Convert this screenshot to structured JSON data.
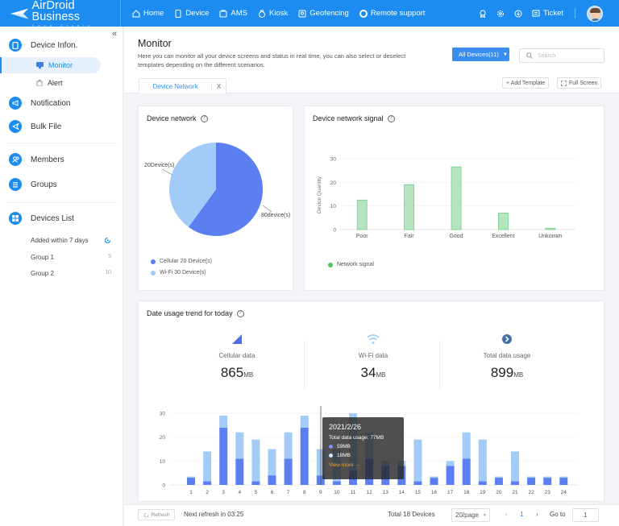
{
  "topbar": {
    "brand": "AirDroid Business",
    "brand_sub": "Sand Studio",
    "nav": [
      {
        "label": "Home",
        "icon": "home-icon"
      },
      {
        "label": "Device",
        "icon": "device-icon"
      },
      {
        "label": "AMS",
        "icon": "ams-icon"
      },
      {
        "label": "Kiosk",
        "icon": "kiosk-icon"
      },
      {
        "label": "Geofencing",
        "icon": "geofencing-icon"
      },
      {
        "label": "Remote support",
        "icon": "remote-support-icon"
      }
    ],
    "ticket_label": "Ticket"
  },
  "sidebar": {
    "collapse": "«",
    "device_info": "Device Infon.",
    "monitor": "Monitor",
    "alert": "Alert",
    "notification": "Notification",
    "bulk_file": "Bulk File",
    "members": "Members",
    "groups": "Groups",
    "devices_list": "Devices List",
    "lists": [
      {
        "label": "Added within 7 days",
        "count": ""
      },
      {
        "label": "Group 1",
        "count": "5"
      },
      {
        "label": "Group 2",
        "count": "10"
      }
    ]
  },
  "header": {
    "title": "Monitor",
    "description": "Here you can monitor all your device screens and status in real time, you can also select or deselect templates depending on the different scenarios.",
    "all_devices": "All Devices(11)",
    "search_placeholder": "Search",
    "tab_label": "Device Network",
    "tab_close": "X",
    "add_template": "+ Add Template",
    "full_screen": "Full Screen"
  },
  "device_network": {
    "title": "Device network",
    "help": "?",
    "label_left": "20Device(s)",
    "label_right": "80device(s)",
    "legend": [
      {
        "label": "Cellular  20 Device(s)",
        "color": "#5b7ff0"
      },
      {
        "label": "Wi-Fi  30 Device(s)",
        "color": "#a3cbf7"
      }
    ]
  },
  "network_signal": {
    "title": "Device network signal",
    "help": "?",
    "legend": "Network signal",
    "legend_color": "#4cc55e"
  },
  "usage": {
    "title": "Date usage trend for today",
    "help": "?",
    "stats": [
      {
        "label": "Cellular data",
        "value": "865",
        "unit": "MB"
      },
      {
        "label": "Wi-Fi data",
        "value": "34",
        "unit": "MB"
      },
      {
        "label": "Total data usage",
        "value": "899",
        "unit": "MB"
      }
    ],
    "tooltip": {
      "date": "2021/2/26",
      "total": "Total data usage: 77MB",
      "cellular": "59MB",
      "wifi": "18MB",
      "more": "View more →"
    }
  },
  "footer": {
    "refresh": "Refresh",
    "next_refresh": "Next refresh in 03:25",
    "total": "Total 18 Devices",
    "per_page": "20/page",
    "page": "1",
    "goto_label": "Go to",
    "goto_value": "1"
  },
  "chart_data": [
    {
      "type": "pie",
      "title": "Device network",
      "categories": [
        "Cellular",
        "Wi-Fi"
      ],
      "values": [
        60,
        40
      ],
      "slice_labels": [
        "80device(s)",
        "20Device(s)"
      ],
      "colors": [
        "#5b7ff0",
        "#a3cbf7"
      ]
    },
    {
      "type": "bar",
      "title": "Device network signal",
      "categories": [
        "Poor",
        "Fair",
        "Good",
        "Excellent",
        "Unkonwn"
      ],
      "values": [
        12.5,
        19,
        26.5,
        7,
        0.5
      ],
      "ylabel": "Device Quantity",
      "yticks": [
        0,
        10,
        20,
        30
      ],
      "ylim": [
        0,
        30
      ],
      "grid": true,
      "legend": "Network signal",
      "color": "#b6e3c0",
      "stroke": "#6fcf83"
    },
    {
      "type": "bar",
      "title": "Date usage trend for today",
      "stacked": true,
      "categories": [
        "1",
        "2",
        "3",
        "4",
        "5",
        "6",
        "7",
        "8",
        "9",
        "10",
        "11",
        "12",
        "13",
        "14",
        "15",
        "16",
        "17",
        "18",
        "19",
        "20",
        "21",
        "22",
        "23",
        "24"
      ],
      "series": [
        {
          "name": "Cellular",
          "color": "#5b7ff0",
          "values": [
            3,
            1.5,
            24,
            11,
            1.5,
            4,
            11,
            24,
            4,
            1.5,
            6,
            11,
            8,
            8,
            1.5,
            3,
            8,
            11,
            1.5,
            3,
            1.5,
            3,
            3,
            3
          ]
        },
        {
          "name": "Wi-Fi",
          "color": "#a3cbf7",
          "values": [
            0.5,
            12.5,
            5,
            11,
            17.5,
            11,
            11,
            5,
            11,
            13.5,
            24,
            11,
            2,
            2,
            17.5,
            0.5,
            2,
            11,
            17.5,
            0.5,
            12.5,
            0.5,
            0.5,
            0.5
          ]
        }
      ],
      "yticks": [
        0,
        10,
        20,
        30
      ],
      "ylim": [
        0,
        30
      ],
      "grid": true
    }
  ]
}
